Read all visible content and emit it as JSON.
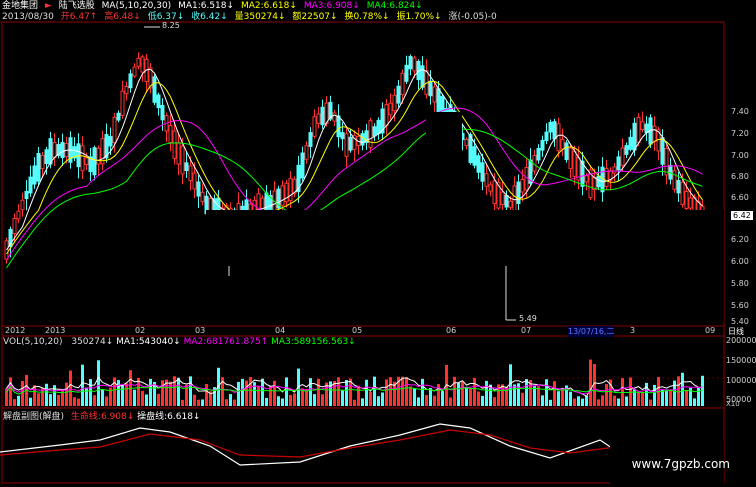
{
  "header": {
    "row1": {
      "title": "金地集团",
      "marker": "►",
      "indicator": "陆飞选股",
      "ma_label": "MA(5,10,20,30)",
      "ma1": "MA1:6.518↓",
      "ma2": "MA2:6.618↓",
      "ma3": "MA3:6.908↓",
      "ma4": "MA4:6.824↓"
    },
    "row2": {
      "date": "2013/08/30",
      "open": "开6.47↑",
      "high": "高6.48↓",
      "low": "低6.37↓",
      "close": "收6.42↓",
      "volume": "量350274↓",
      "amount": "额22507↓",
      "turnover": "换0.78%↓",
      "amplitude": "振1.70%↓",
      "change": "涨(-0.05)-0"
    }
  },
  "price_panel": {
    "peak_label": "8.25",
    "low_label": "5.49",
    "y_ticks": [
      "7.40",
      "7.20",
      "7.00",
      "6.80",
      "6.60",
      "6.42",
      "6.20",
      "6.00",
      "5.80",
      "5.60",
      "5.40"
    ],
    "current_price": "6.42",
    "x_ticks": [
      "2012",
      "2013",
      "02",
      "03",
      "04",
      "05",
      "06",
      "07",
      "13/07/16,二",
      "3",
      "09"
    ],
    "x_axis_unit": "日线"
  },
  "volume_panel": {
    "title": "VOL(5,10,20)",
    "v": "350274↓",
    "ma1": "MA1:543040↓",
    "ma2": "MA2:681761.875↑",
    "ma3": "MA3:589156.563↓",
    "y_ticks": [
      "200000",
      "150000",
      "100000",
      "50000",
      "X10"
    ]
  },
  "sub_panel": {
    "title": "解盘副图(解盘)",
    "life": "生命线:6.908↓",
    "control": "操盘线:6.618↓"
  },
  "watermark": "www.7gpzb.com",
  "colors": {
    "up": "#ff3232",
    "down": "#54fcfc",
    "ma1": "#ffffff",
    "ma2": "#ffff00",
    "ma3": "#ff00ff",
    "ma4": "#00ff00",
    "grid": "#8b0000"
  }
}
